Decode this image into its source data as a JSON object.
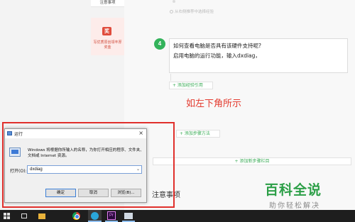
{
  "sidebar": {
    "notes_tab": "注意事项",
    "promo_icon": "奖",
    "promo_text": "写优质原创领丰厚奖金"
  },
  "editor": {
    "top_link": "从右侧推荐中选择经验",
    "step_number": "4",
    "step_text_line1": "如何查看电脑是否具有该硬件支持呢?",
    "step_text_line2": "启用电脑的运行功能，输入dxdiag，",
    "add_quote": "+ 添加经验引用",
    "add_method": "+ 添加步骤方法",
    "add_section": "+ 添加新步骤栏目",
    "notes_heading": "注意事项"
  },
  "annotation": "如左下角所示",
  "run_dialog": {
    "title": "运行",
    "close_glyph": "×",
    "description": "Windows 将根据你所输入的名称，为你打开相应的程序、文件夹、文档或 Internet 资源。",
    "open_label": "打开(O):",
    "input_value": "dxdiag",
    "dropdown_glyph": "⌄",
    "ok_label": "确定",
    "cancel_label": "取消",
    "browse_label": "浏览(B)..."
  },
  "taskbar": {
    "pr_label": "Pr"
  },
  "watermark": {
    "title": "百科全说",
    "subtitle": "助你轻松解决"
  },
  "colors": {
    "accent_green": "#33b35b",
    "annotation_red": "#e33b2f"
  }
}
